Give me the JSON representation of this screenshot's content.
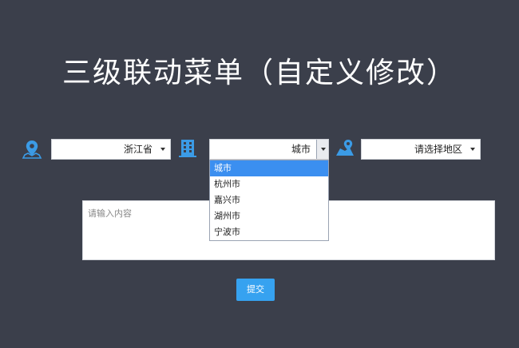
{
  "title": "三级联动菜单（自定义修改）",
  "province_select": {
    "value": "浙江省"
  },
  "city_select": {
    "value": "城市",
    "options": [
      "城市",
      "杭州市",
      "嘉兴市",
      "湖州市",
      "宁波市"
    ]
  },
  "district_select": {
    "value": "请选择地区"
  },
  "message": {
    "placeholder": "请输入内容"
  },
  "submit_label": "提交",
  "colors": {
    "background": "#3b3f4b",
    "icon": "#3b9be6",
    "accent": "#36a2f0",
    "selected_option": "#3b8ff0"
  },
  "icons": [
    "map-pin-icon",
    "building-icon",
    "map-marker-icon"
  ]
}
